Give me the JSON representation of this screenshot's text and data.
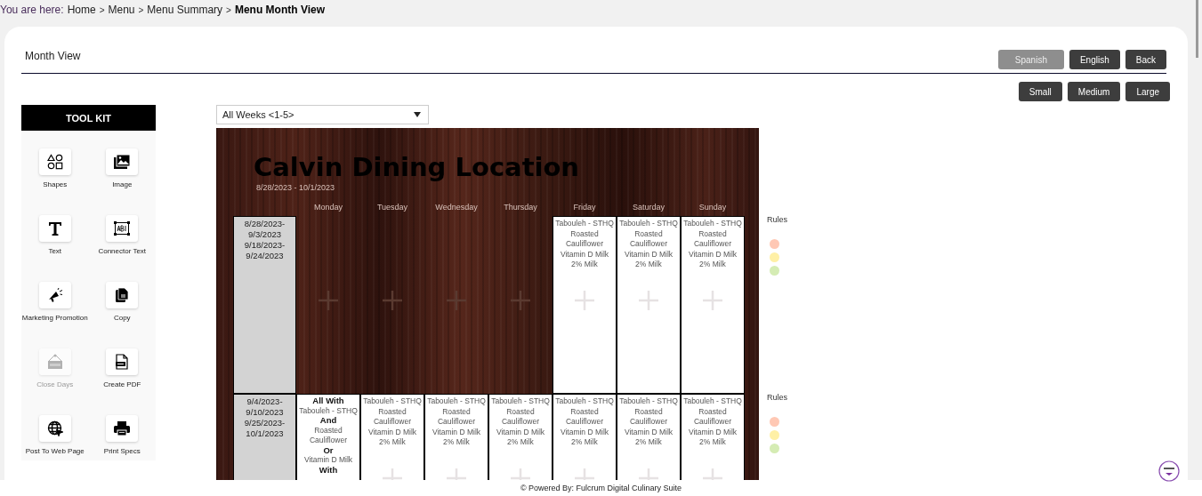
{
  "breadcrumb": {
    "prefix": "You are here:",
    "items": [
      {
        "label": "Home",
        "current": false,
        "separator": ">"
      },
      {
        "label": "Menu",
        "current": false,
        "separator": ">"
      },
      {
        "label": "Menu Summary",
        "current": false,
        "separator": ">"
      },
      {
        "label": "Menu Month View",
        "current": true
      }
    ]
  },
  "page_title": "Month View",
  "language_buttons": [
    {
      "label": "Spanish",
      "disabled": true
    },
    {
      "label": "English",
      "disabled": false
    },
    {
      "label": "Back",
      "disabled": false
    }
  ],
  "size_buttons": [
    {
      "label": "Small"
    },
    {
      "label": "Medium"
    },
    {
      "label": "Large"
    }
  ],
  "toolkit": {
    "title": "TOOL KIT",
    "items": [
      {
        "label": "Shapes",
        "kind": "shapes",
        "disabled": false
      },
      {
        "label": "Image",
        "kind": "image",
        "disabled": false
      },
      {
        "label": "Text",
        "kind": "text",
        "disabled": false
      },
      {
        "label": "Connector Text",
        "kind": "connector",
        "disabled": false
      },
      {
        "label": "Marketing Promotion",
        "kind": "megaphone",
        "disabled": false
      },
      {
        "label": "Copy",
        "kind": "copy",
        "disabled": false
      },
      {
        "label": "Close Days",
        "kind": "closed",
        "disabled": true
      },
      {
        "label": "Create PDF",
        "kind": "pdf",
        "disabled": false
      },
      {
        "label": "Post To Web Page",
        "kind": "globe",
        "disabled": false
      },
      {
        "label": "Print Specs",
        "kind": "printer",
        "disabled": false
      }
    ]
  },
  "week_select": {
    "value": "All Weeks <1-5>"
  },
  "calendar": {
    "title": "Calvin Dining Location",
    "date_range": "8/28/2023 - 10/1/2023",
    "days": [
      "Monday",
      "Tuesday",
      "Wednesday",
      "Thursday",
      "Friday",
      "Saturday",
      "Sunday"
    ],
    "weeks": [
      {
        "dates": [
          "8/28/2023-",
          "9/3/2023",
          "9/18/2023-",
          "9/24/2023"
        ],
        "cells": [
          {
            "kind": "empty"
          },
          {
            "kind": "empty"
          },
          {
            "kind": "empty"
          },
          {
            "kind": "empty"
          },
          {
            "kind": "menu",
            "items": [
              "Tabouleh - STHQ",
              "Roasted Cauliflower",
              "Vitamin D Milk",
              "2% Milk"
            ]
          },
          {
            "kind": "menu",
            "items": [
              "Tabouleh - STHQ",
              "Roasted Cauliflower",
              "Vitamin D Milk",
              "2% Milk"
            ]
          },
          {
            "kind": "menu",
            "items": [
              "Tabouleh - STHQ",
              "Roasted Cauliflower",
              "Vitamin D Milk",
              "2% Milk"
            ]
          }
        ],
        "rules": {
          "label": "Rules",
          "lights": [
            {
              "color": "#ffc8b4"
            },
            {
              "color": "#fff0a6"
            },
            {
              "color": "#d5ecb4"
            }
          ]
        }
      },
      {
        "dates": [
          "9/4/2023-",
          "9/10/2023",
          "9/25/2023-",
          "10/1/2023"
        ],
        "cells": [
          {
            "kind": "rule",
            "lines": [
              {
                "kind": "operator",
                "text": "All With"
              },
              {
                "kind": "item",
                "text": "Tabouleh - STHQ"
              },
              {
                "kind": "operator",
                "text": "And"
              },
              {
                "kind": "item",
                "text": "Roasted Cauliflower"
              },
              {
                "kind": "operator",
                "text": "Or"
              },
              {
                "kind": "item",
                "text": "Vitamin D Milk"
              },
              {
                "kind": "operator",
                "text": "With"
              }
            ]
          },
          {
            "kind": "menu",
            "items": [
              "Tabouleh - STHQ",
              "Roasted Cauliflower",
              "Vitamin D Milk",
              "2% Milk"
            ]
          },
          {
            "kind": "menu",
            "items": [
              "Tabouleh - STHQ",
              "Roasted Cauliflower",
              "Vitamin D Milk",
              "2% Milk"
            ]
          },
          {
            "kind": "menu",
            "items": [
              "Tabouleh - STHQ",
              "Roasted Cauliflower",
              "Vitamin D Milk",
              "2% Milk"
            ]
          },
          {
            "kind": "menu",
            "items": [
              "Tabouleh - STHQ",
              "Roasted Cauliflower",
              "Vitamin D Milk",
              "2% Milk"
            ]
          },
          {
            "kind": "menu",
            "items": [
              "Tabouleh - STHQ",
              "Roasted Cauliflower",
              "Vitamin D Milk",
              "2% Milk"
            ]
          },
          {
            "kind": "menu",
            "items": [
              "Tabouleh - STHQ",
              "Roasted Cauliflower",
              "Vitamin D Milk",
              "2% Milk"
            ]
          }
        ],
        "rules": {
          "label": "Rules",
          "lights": [
            {
              "color": "#ffc8b4"
            },
            {
              "color": "#fff0a6"
            },
            {
              "color": "#d5ecb4"
            }
          ]
        }
      }
    ]
  },
  "footer": "© Powered By: Fulcrum Digital Culinary Suite"
}
